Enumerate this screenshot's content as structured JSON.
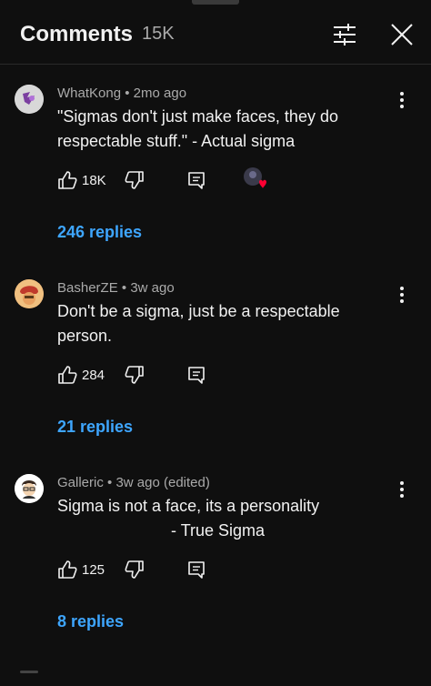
{
  "header": {
    "title": "Comments",
    "count": "15K"
  },
  "comments": [
    {
      "author": "WhatKong",
      "separator": "•",
      "time": "2mo ago",
      "text": "\"Sigmas don't just make faces, they do respectable stuff.\" - Actual sigma",
      "likes": "18K",
      "replies": "246 replies",
      "hearted": true
    },
    {
      "author": "BasherZE",
      "separator": "•",
      "time": "3w ago",
      "text": "Don't be a sigma, just be a respectable person.",
      "likes": "284",
      "replies": "21 replies",
      "hearted": false
    },
    {
      "author": "Galleric",
      "separator": "•",
      "time": "3w ago (edited)",
      "text": "Sigma is not a face, its a personality\n                         - True Sigma",
      "likes": "125",
      "replies": "8 replies",
      "hearted": false
    }
  ],
  "colors": {
    "background": "#0f0f0f",
    "text": "#f1f1f1",
    "meta": "#aaaaaa",
    "link": "#3ea6ff",
    "heart": "#ff0033"
  }
}
